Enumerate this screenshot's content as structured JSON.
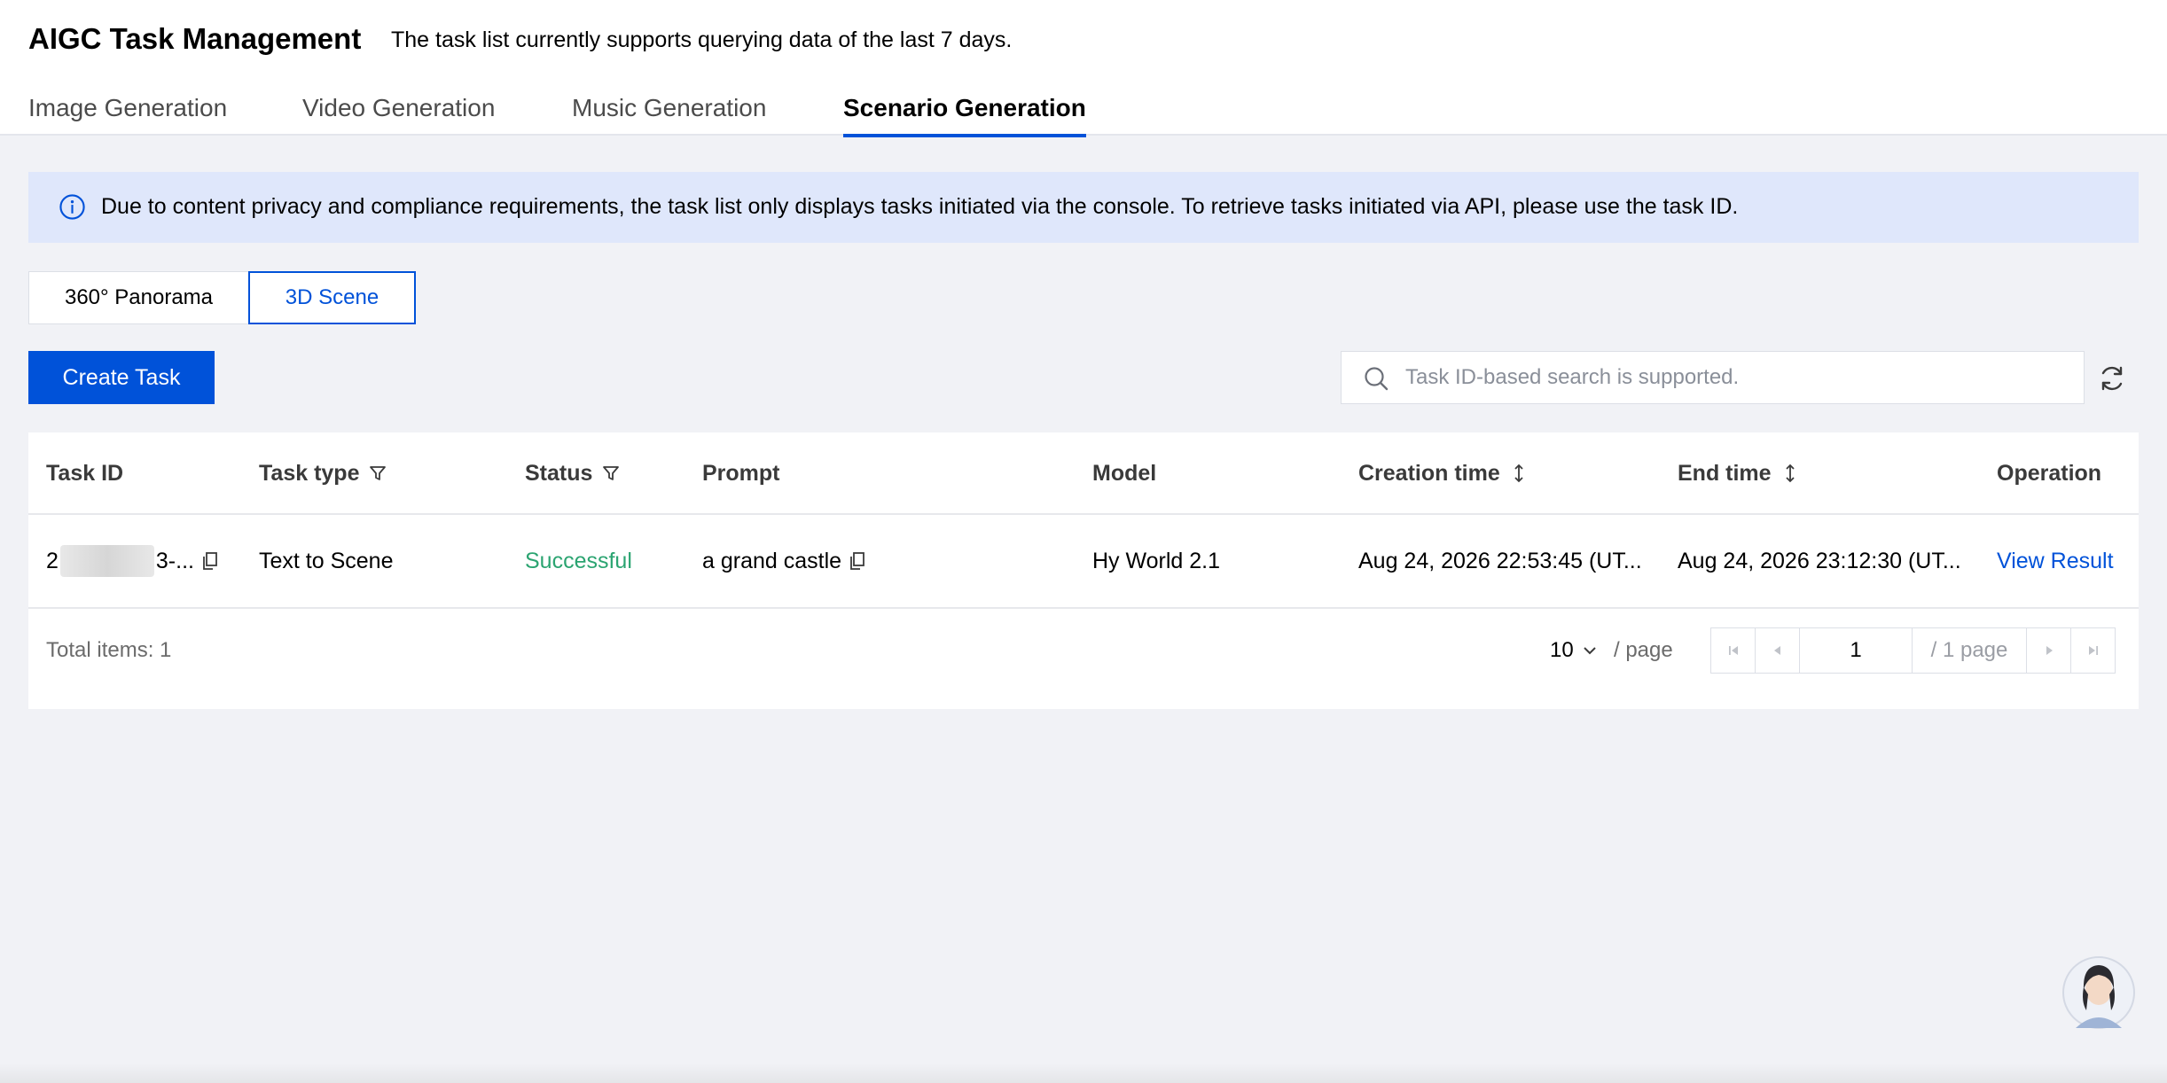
{
  "header": {
    "title": "AIGC Task Management",
    "subtitle": "The task list currently supports querying data of the last 7 days.",
    "tabs": [
      {
        "label": "Image Generation",
        "active": false
      },
      {
        "label": "Video Generation",
        "active": false
      },
      {
        "label": "Music Generation",
        "active": false
      },
      {
        "label": "Scenario Generation",
        "active": true
      }
    ]
  },
  "notice": {
    "icon": "info-icon",
    "text": "Due to content privacy and compliance requirements, the task list only displays tasks initiated via the console. To retrieve tasks initiated via API, please use the task ID."
  },
  "segments": {
    "options": [
      "360° Panorama",
      "3D Scene"
    ],
    "selected": "3D Scene"
  },
  "toolbar": {
    "create_label": "Create Task",
    "search_placeholder": "Task ID-based search is supported.",
    "search_value": ""
  },
  "table": {
    "columns": [
      "Task ID",
      "Task type",
      "Status",
      "Prompt",
      "Model",
      "Creation time",
      "End time",
      "Operation"
    ],
    "rows": [
      {
        "task_id_start": "2",
        "task_id_end": "3-...",
        "task_type": "Text to Scene",
        "status": "Successful",
        "prompt": "a grand castle",
        "model": "Hy World 2.1",
        "creation_time": "Aug 24, 2026 22:53:45 (UT...",
        "end_time": "Aug 24, 2026 23:12:30 (UT...",
        "operation": "View Result"
      }
    ]
  },
  "pagination": {
    "total_label": "Total items: 1",
    "page_size": "10",
    "page_size_unit": "/ page",
    "current_page": "1",
    "total_pages_label": "/ 1 page"
  },
  "colors": {
    "accent": "#0052d9",
    "success": "#2ba471",
    "notice_bg": "#dfe7fb"
  }
}
